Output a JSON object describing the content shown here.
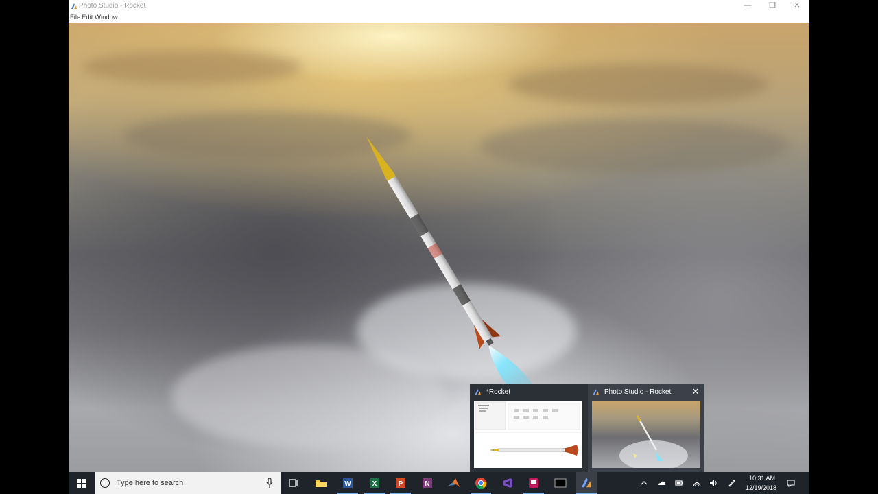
{
  "window": {
    "title": "Photo Studio - Rocket",
    "menu": [
      "File",
      "Edit",
      "Window"
    ]
  },
  "taskbar": {
    "search_placeholder": "Type here to search",
    "time": "10:31 AM",
    "date": "12/19/2018",
    "pinned": [
      "task-view",
      "file-explorer",
      "word",
      "excel",
      "powerpoint",
      "onenote",
      "matlab",
      "chrome",
      "visual-studio",
      "presentation-app",
      "terminal",
      "photo-studio"
    ]
  },
  "previews": [
    {
      "title": "*Rocket"
    },
    {
      "title": "Photo Studio - Rocket"
    }
  ],
  "colors": {
    "taskbar_bg": "#1f232a",
    "preview_bg": "#2b2f36",
    "accent": "#7fb0e6"
  }
}
